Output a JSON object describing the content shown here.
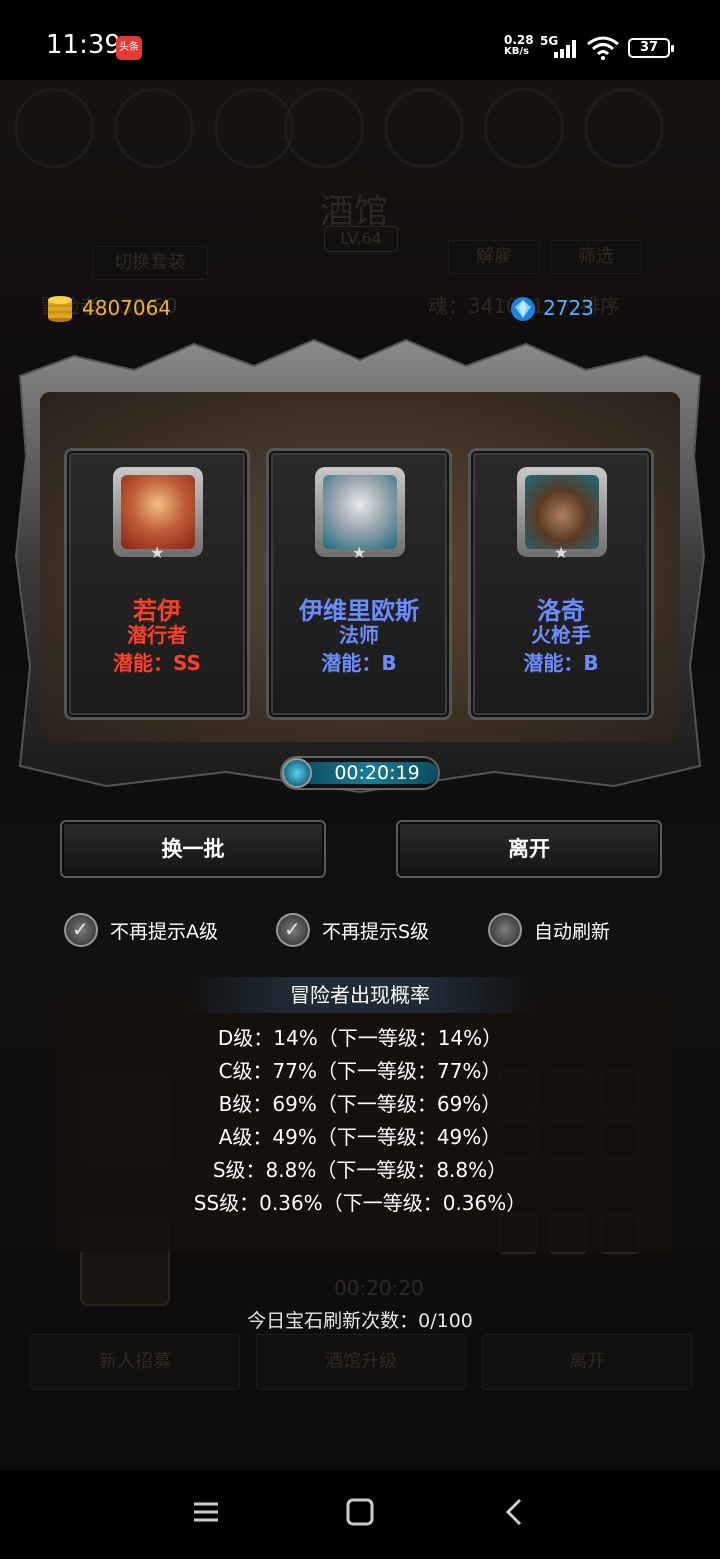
{
  "status_bar": {
    "time": "11:39",
    "app_badge": "头条",
    "net_speed_value": "0.28",
    "net_speed_unit": "KB/s",
    "network_type": "5G",
    "battery": "37"
  },
  "background": {
    "title": "酒馆",
    "level": "LV.64",
    "switch_outfit": "切换套装",
    "adventurer_count": "冒险者：32/50",
    "dismiss": "解雇",
    "filter": "筛选",
    "soul": "魂：341091",
    "sort": "排序",
    "bg_timer": "00:20:20",
    "new_recruit": "新人招募",
    "tavern_upgrade": "酒馆升级",
    "leave": "离开"
  },
  "currency": {
    "gold": "4807064",
    "gems": "2723"
  },
  "heroes": [
    {
      "name": "若伊",
      "class": "潜行者",
      "potential": "潜能：SS",
      "color": "#ff3f27",
      "portrait": "red-hood-woman-portrait"
    },
    {
      "name": "伊维里欧斯",
      "class": "法师",
      "potential": "潜能：B",
      "color": "#6b8cff",
      "portrait": "elf-mage-portrait"
    },
    {
      "name": "洛奇",
      "class": "火枪手",
      "potential": "潜能：B",
      "color": "#6b8cff",
      "portrait": "cowboy-gunner-portrait"
    }
  ],
  "timer": "00:20:19",
  "actions": {
    "refresh_batch": "换一批",
    "leave": "离开"
  },
  "options": [
    {
      "label": "不再提示A级",
      "checked": true
    },
    {
      "label": "不再提示S级",
      "checked": true
    },
    {
      "label": "自动刷新",
      "checked": false
    }
  ],
  "probability": {
    "title": "冒险者出现概率",
    "lines": [
      "D级：14%（下一等级：14%）",
      "C级：77%（下一等级：77%）",
      "B级：69%（下一等级：69%）",
      "A级：49%（下一等级：49%）",
      "S级：8.8%（下一等级：8.8%）",
      "SS级：0.36%（下一等级：0.36%）"
    ]
  },
  "gem_refresh": "今日宝石刷新次数：0/100",
  "colors": {
    "gold": "#f2b322",
    "gem": "#4cb1ff",
    "ss_rank": "#ff3f27",
    "b_rank": "#6b8cff"
  }
}
